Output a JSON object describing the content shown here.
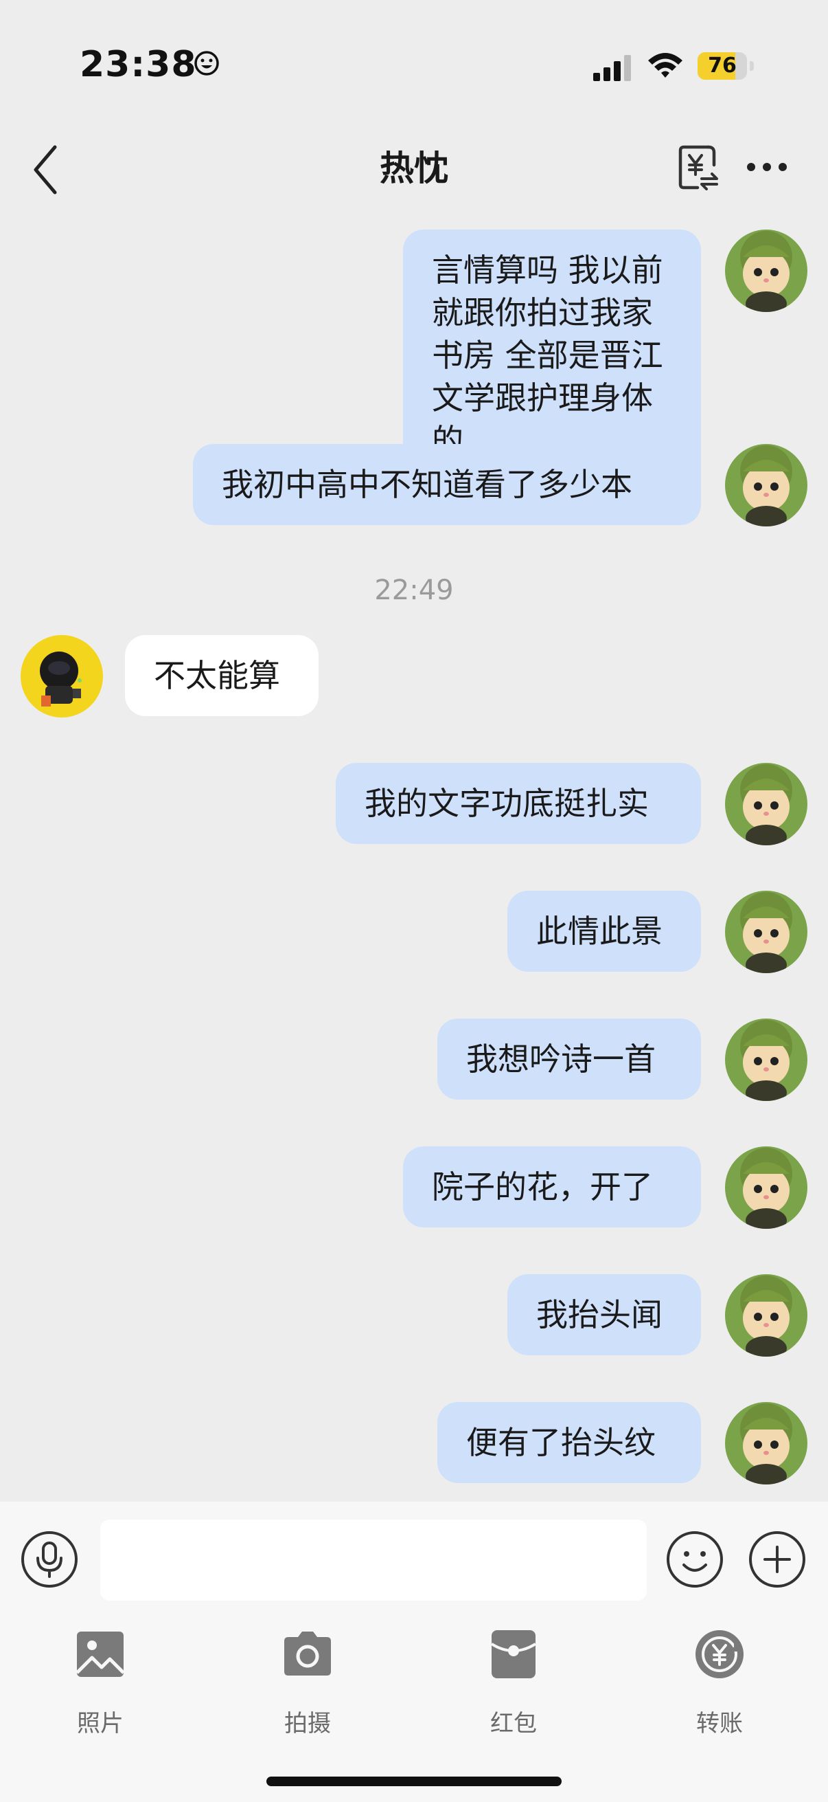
{
  "status_bar": {
    "time": "23:38",
    "battery_level": "76"
  },
  "header": {
    "title": "热忱"
  },
  "messages": [
    {
      "side": "right",
      "text": "言情算吗 我以前就跟你拍过我家书房 全部是晋江文学跟护理身体的"
    },
    {
      "side": "right",
      "text": "我初中高中不知道看了多少本"
    },
    {
      "timestamp": "22:49"
    },
    {
      "side": "left",
      "text": "不太能算"
    },
    {
      "side": "right",
      "text": "我的文字功底挺扎实"
    },
    {
      "side": "right",
      "text": "此情此景"
    },
    {
      "side": "right",
      "text": "我想吟诗一首"
    },
    {
      "side": "right",
      "text": "院子的花，开了"
    },
    {
      "side": "right",
      "text": "我抬头闻"
    },
    {
      "side": "right",
      "text": "便有了抬头纹"
    }
  ],
  "input_bar": {
    "value": "",
    "placeholder": ""
  },
  "actions": [
    {
      "label": "照片",
      "icon": "photo-icon"
    },
    {
      "label": "拍摄",
      "icon": "camera-icon"
    },
    {
      "label": "红包",
      "icon": "red-packet-icon"
    },
    {
      "label": "转账",
      "icon": "transfer-icon"
    }
  ],
  "colors": {
    "background": "#ededed",
    "bubble_self": "#cfe0fb",
    "bubble_other": "#ffffff",
    "battery": "#f5cf2c",
    "icon_gray": "#7a7a7a"
  }
}
